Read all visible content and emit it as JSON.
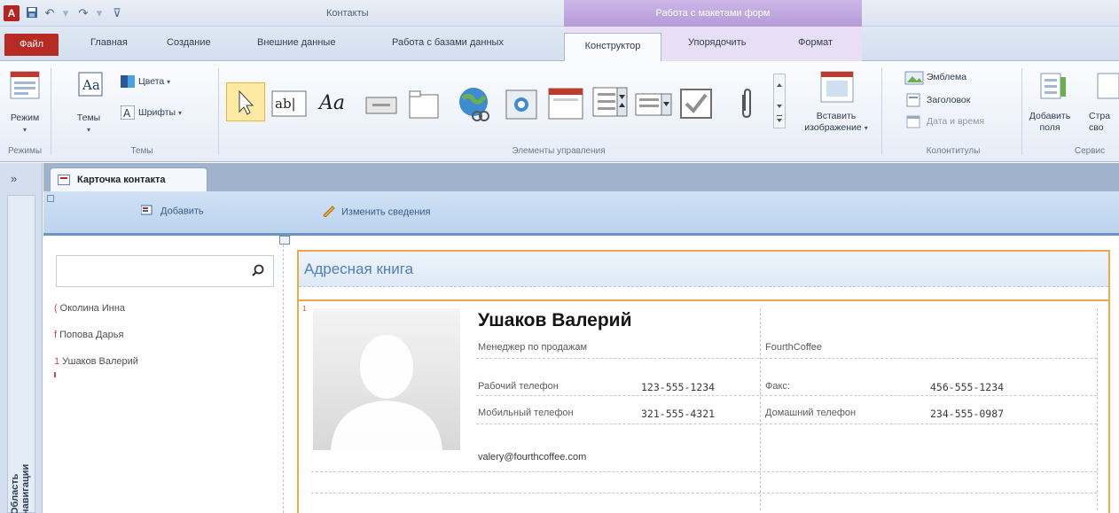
{
  "titlebar": {
    "app_logo": "A",
    "window_title": "Контакты",
    "context_title": "Работа с макетами форм",
    "qat_icons": [
      "save-icon",
      "undo-icon",
      "redo-icon",
      "customize-qat-icon"
    ]
  },
  "tabs": {
    "file": "Файл",
    "home": "Главная",
    "create": "Создание",
    "external": "Внешние данные",
    "dbtools": "Работа с базами данных",
    "design": "Конструктор",
    "arrange": "Упорядочить",
    "format": "Формат"
  },
  "ribbon": {
    "views": {
      "view_label": "Режим",
      "group": "Режимы"
    },
    "themes": {
      "themes_label": "Темы",
      "colors_label": "Цвета",
      "fonts_label": "Шрифты",
      "group": "Темы"
    },
    "controls": {
      "group": "Элементы управления",
      "icons": [
        "select-arrow-icon",
        "textbox-icon",
        "label-icon",
        "button-icon",
        "tab-control-icon",
        "hyperlink-icon",
        "image-icon",
        "navigation-icon",
        "combobox-icon",
        "listbox-icon",
        "checkbox-icon",
        "attachment-icon"
      ]
    },
    "insert_image": {
      "label_line1": "Вставить",
      "label_line2": "изображение"
    },
    "header_footer": {
      "logo": "Эмблема",
      "title": "Заголовок",
      "datetime": "Дата и время",
      "group": "Колонтитулы"
    },
    "tools": {
      "add_fields_line1": "Добавить",
      "add_fields_line2": "поля",
      "page_line1": "Стра",
      "page_line2": "сво",
      "group": "Сервис"
    }
  },
  "navpane": {
    "toggle": "»",
    "label": "Область навигации"
  },
  "document": {
    "tab_label": "Карточка контакта"
  },
  "form_header": {
    "add_button": "Добавить",
    "edit_button": "Изменить сведения"
  },
  "search": {
    "value": "",
    "placeholder": ""
  },
  "contacts_list": [
    {
      "marker": "(",
      "name": "Околина Инна"
    },
    {
      "marker": "f",
      "name": "Попова Дарья"
    },
    {
      "marker": "1",
      "name": "Ушаков Валерий"
    }
  ],
  "address_book": {
    "title": "Адресная книга",
    "record_marker": "1",
    "name": "Ушаков Валерий",
    "job_title": "Менеджер по продажам",
    "company": "FourthCoffee",
    "work_phone_label": "Рабочий телефон",
    "work_phone": "123-555-1234",
    "fax_label": "Факс:",
    "fax": "456-555-1234",
    "mobile_label": "Мобильный телефон",
    "mobile": "321-555-4321",
    "home_phone_label": "Домашний телефон",
    "home_phone": "234-555-0987",
    "email": "valery@fourthcoffee.com"
  },
  "colors": {
    "file_tab": "#b72b24",
    "context_tab": "#b49ad9",
    "selection_outline": "#eaa84d",
    "header_band": "#bcd4ee",
    "title_blue": "#4f7fb8"
  }
}
